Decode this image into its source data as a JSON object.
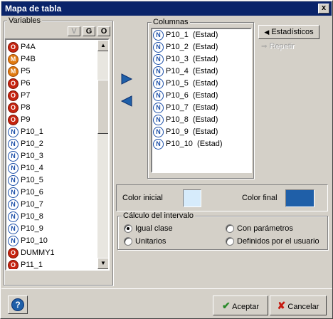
{
  "window": {
    "title": "Mapa de tabla",
    "close_glyph": "x"
  },
  "variables": {
    "label": "Variables",
    "filter_buttons": [
      "V",
      "G",
      "O"
    ],
    "items": [
      {
        "type": "O",
        "name": "P4A"
      },
      {
        "type": "M",
        "name": "P4B"
      },
      {
        "type": "M",
        "name": "P5"
      },
      {
        "type": "O",
        "name": "P6"
      },
      {
        "type": "O",
        "name": "P7"
      },
      {
        "type": "O",
        "name": "P8"
      },
      {
        "type": "O",
        "name": "P9"
      },
      {
        "type": "N",
        "name": "P10_1"
      },
      {
        "type": "N",
        "name": "P10_2"
      },
      {
        "type": "N",
        "name": "P10_3"
      },
      {
        "type": "N",
        "name": "P10_4"
      },
      {
        "type": "N",
        "name": "P10_5"
      },
      {
        "type": "N",
        "name": "P10_6"
      },
      {
        "type": "N",
        "name": "P10_7"
      },
      {
        "type": "N",
        "name": "P10_8"
      },
      {
        "type": "N",
        "name": "P10_9"
      },
      {
        "type": "N",
        "name": "P10_10"
      },
      {
        "type": "O",
        "name": "DUMMY1"
      },
      {
        "type": "O",
        "name": "P11_1"
      }
    ]
  },
  "columnas": {
    "label": "Columnas",
    "items": [
      {
        "type": "N",
        "name": "P10_1  (Estad)"
      },
      {
        "type": "N",
        "name": "P10_2  (Estad)"
      },
      {
        "type": "N",
        "name": "P10_3  (Estad)"
      },
      {
        "type": "N",
        "name": "P10_4  (Estad)"
      },
      {
        "type": "N",
        "name": "P10_5  (Estad)"
      },
      {
        "type": "N",
        "name": "P10_6  (Estad)"
      },
      {
        "type": "N",
        "name": "P10_7  (Estad)"
      },
      {
        "type": "N",
        "name": "P10_8  (Estad)"
      },
      {
        "type": "N",
        "name": "P10_9  (Estad)"
      },
      {
        "type": "N",
        "name": "P10_10  (Estad)"
      }
    ]
  },
  "side_buttons": {
    "estadisticos": "Estadísticos",
    "repetir": "Repetir"
  },
  "colors": {
    "color_inicial_label": "Color inicial",
    "color_inicial": "#d6ebfb",
    "color_final_label": "Color final",
    "color_final": "#1f5fa8"
  },
  "intervalo": {
    "label": "Cálculo del intervalo",
    "options": [
      {
        "label": "Igual clase",
        "selected": true
      },
      {
        "label": "Con parámetros",
        "selected": false
      },
      {
        "label": "Unitarios",
        "selected": false
      },
      {
        "label": "Definidos por el usuario",
        "selected": false
      }
    ]
  },
  "footer": {
    "aceptar": "Aceptar",
    "cancelar": "Cancelar",
    "help_glyph": "?"
  }
}
